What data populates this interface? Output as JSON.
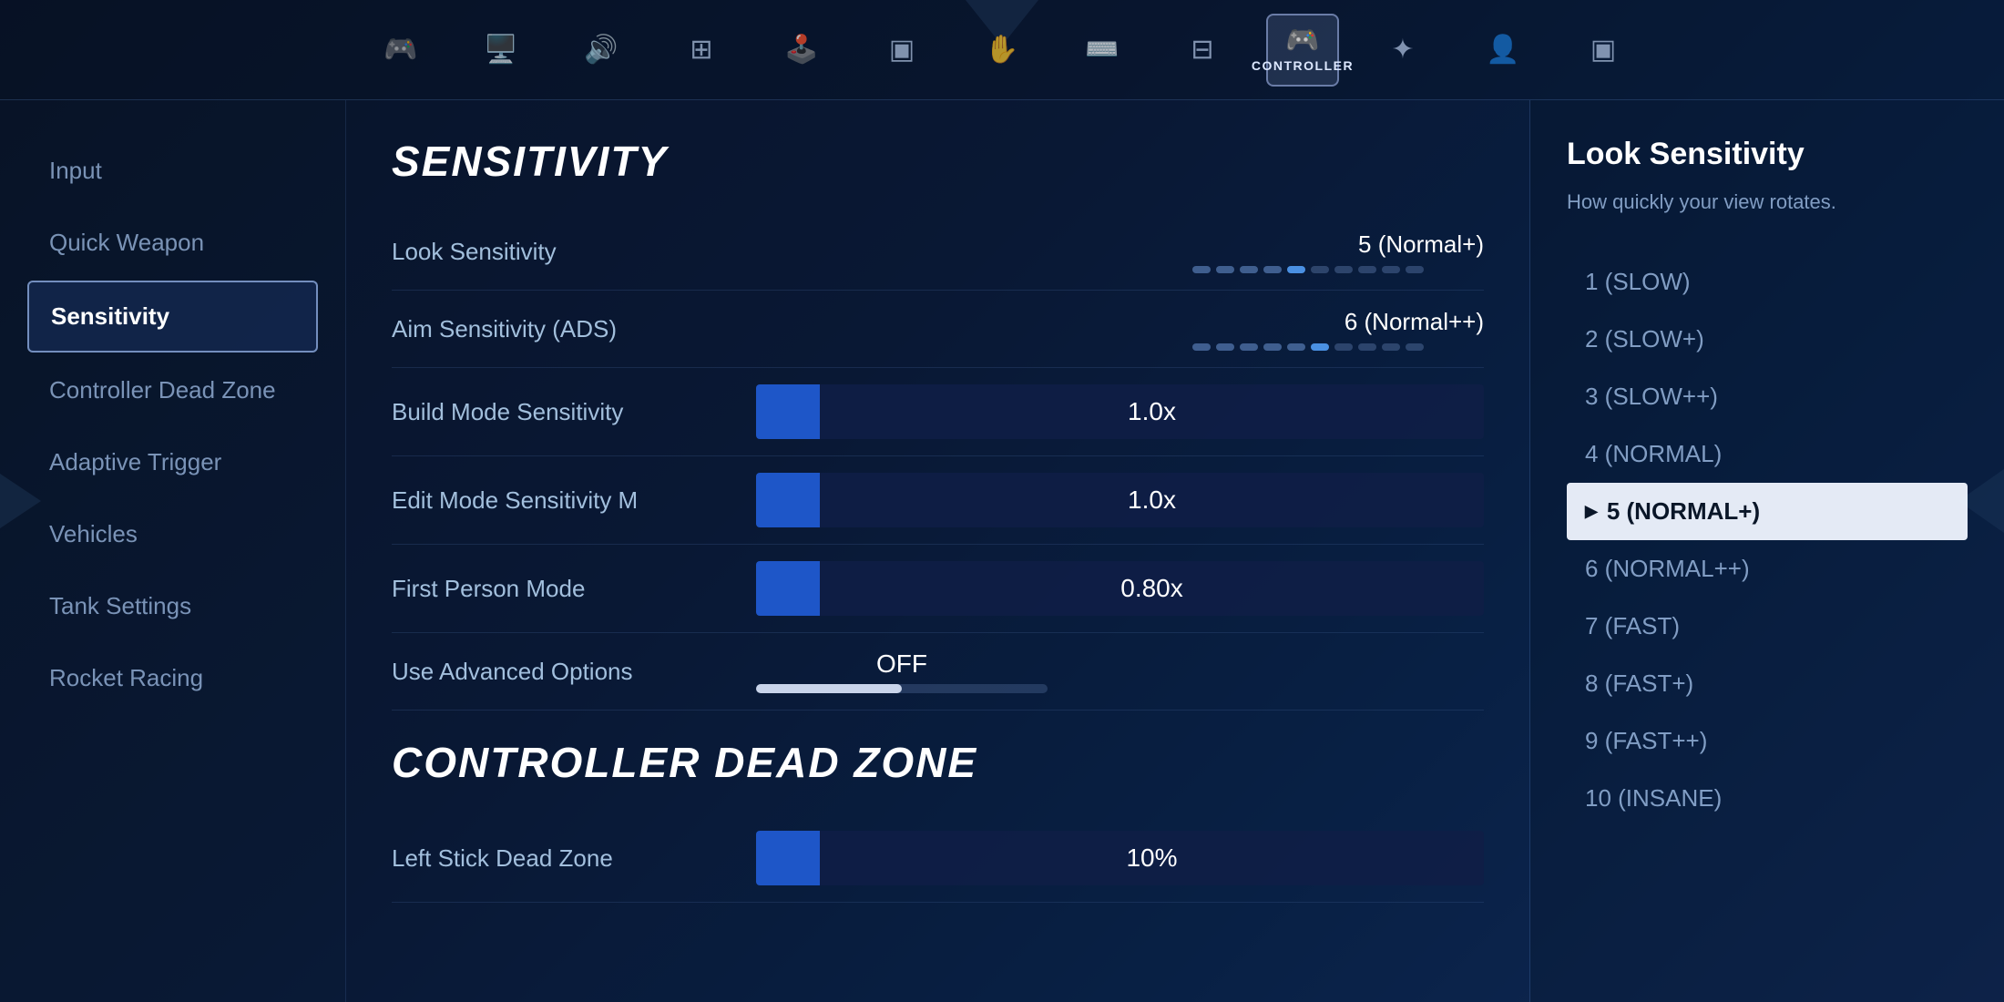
{
  "nav": {
    "items": [
      {
        "id": "input",
        "icon": "🎮",
        "label": ""
      },
      {
        "id": "display",
        "icon": "🖥️",
        "label": ""
      },
      {
        "id": "audio",
        "icon": "🔊",
        "label": ""
      },
      {
        "id": "ui",
        "icon": "⊞",
        "label": ""
      },
      {
        "id": "gamepad",
        "icon": "🕹️",
        "label": ""
      },
      {
        "id": "window",
        "icon": "▣",
        "label": ""
      },
      {
        "id": "touch",
        "icon": "✋",
        "label": ""
      },
      {
        "id": "keyboard",
        "icon": "⌨️",
        "label": ""
      },
      {
        "id": "network",
        "icon": "⊟",
        "label": ""
      },
      {
        "id": "controller",
        "icon": "🎮",
        "label": "CONTROLLER",
        "active": true
      },
      {
        "id": "extras",
        "icon": "✦",
        "label": ""
      },
      {
        "id": "account",
        "icon": "👤",
        "label": ""
      },
      {
        "id": "more",
        "icon": "▣",
        "label": ""
      }
    ]
  },
  "sidebar": {
    "items": [
      {
        "id": "input",
        "label": "Input",
        "active": false
      },
      {
        "id": "quick-weapon",
        "label": "Quick Weapon",
        "active": false
      },
      {
        "id": "sensitivity",
        "label": "Sensitivity",
        "active": true
      },
      {
        "id": "controller-dead-zone",
        "label": "Controller Dead Zone",
        "active": false
      },
      {
        "id": "adaptive-trigger",
        "label": "Adaptive Trigger",
        "active": false
      },
      {
        "id": "vehicles",
        "label": "Vehicles",
        "active": false
      },
      {
        "id": "tank-settings",
        "label": "Tank Settings",
        "active": false
      },
      {
        "id": "rocket-racing",
        "label": "Rocket Racing",
        "active": false
      }
    ]
  },
  "sensitivity_section": {
    "title": "SENSITIVITY",
    "settings": [
      {
        "id": "look-sensitivity",
        "label": "Look Sensitivity",
        "type": "slider",
        "value": "5 (Normal+)",
        "filled_dots": 5,
        "total_dots": 10
      },
      {
        "id": "aim-sensitivity",
        "label": "Aim Sensitivity (ADS)",
        "type": "slider",
        "value": "6 (Normal++)",
        "filled_dots": 6,
        "total_dots": 10
      },
      {
        "id": "build-mode",
        "label": "Build Mode Sensitivity",
        "type": "bar",
        "value": "1.0x",
        "bar_percent": 15
      },
      {
        "id": "edit-mode",
        "label": "Edit Mode Sensitivity M",
        "type": "bar",
        "value": "1.0x",
        "bar_percent": 15
      },
      {
        "id": "first-person",
        "label": "First Person Mode",
        "type": "bar",
        "value": "0.80x",
        "bar_percent": 12
      },
      {
        "id": "use-advanced",
        "label": "Use Advanced Options",
        "type": "toggle",
        "value": "OFF"
      }
    ]
  },
  "dead_zone_section": {
    "title": "CONTROLLER DEAD ZONE",
    "settings": [
      {
        "id": "left-stick",
        "label": "Left Stick Dead Zone",
        "type": "bar",
        "value": "10%",
        "bar_percent": 8
      }
    ]
  },
  "right_panel": {
    "title": "Look Sensitivity",
    "description": "How quickly your view rotates.",
    "options": [
      {
        "id": 1,
        "label": "1 (SLOW)",
        "selected": false
      },
      {
        "id": 2,
        "label": "2 (SLOW+)",
        "selected": false
      },
      {
        "id": 3,
        "label": "3 (SLOW++)",
        "selected": false
      },
      {
        "id": 4,
        "label": "4 (NORMAL)",
        "selected": false
      },
      {
        "id": 5,
        "label": "5 (NORMAL+)",
        "selected": true
      },
      {
        "id": 6,
        "label": "6 (NORMAL++)",
        "selected": false
      },
      {
        "id": 7,
        "label": "7 (FAST)",
        "selected": false
      },
      {
        "id": 8,
        "label": "8 (FAST+)",
        "selected": false
      },
      {
        "id": 9,
        "label": "9 (FAST++)",
        "selected": false
      },
      {
        "id": 10,
        "label": "10 (INSANE)",
        "selected": false
      }
    ]
  }
}
